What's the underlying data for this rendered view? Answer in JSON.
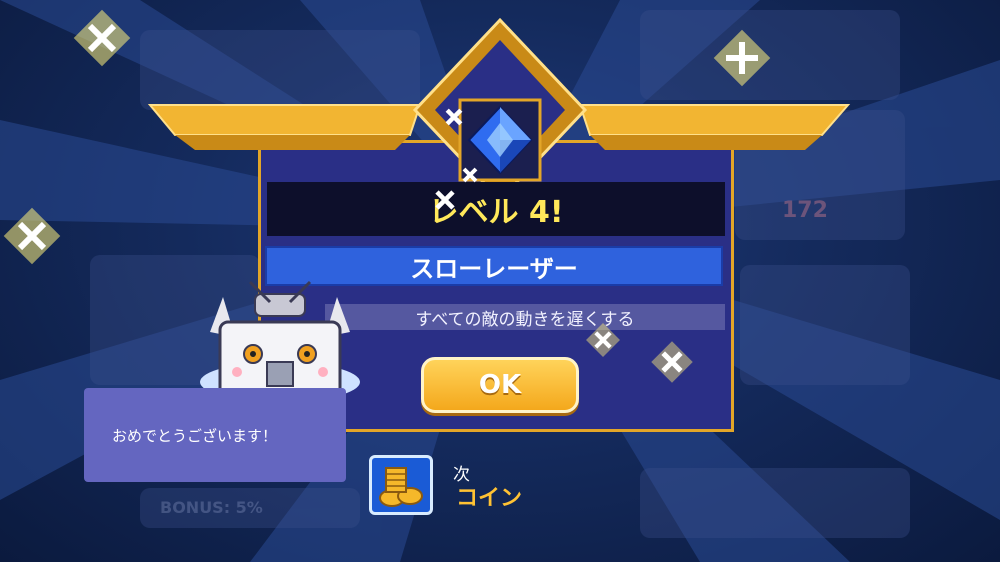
{
  "dialog": {
    "level_text": "レベル 4!",
    "skill_name": "スローレーザー",
    "skill_description": "すべての敵の動きを遅くする",
    "ok_label": "OK"
  },
  "character": {
    "speech": "おめでとうございます！"
  },
  "next_reward": {
    "label": "次",
    "value": "コイン",
    "icon": "coin-stack-icon"
  },
  "background": {
    "badge_value": "172",
    "bonus_text": "BONUS: 5%"
  },
  "colors": {
    "gold": "#e3a628",
    "modal": "#2a2f86",
    "skill_bar": "#2f62dd",
    "level_text": "#ffe85a"
  }
}
